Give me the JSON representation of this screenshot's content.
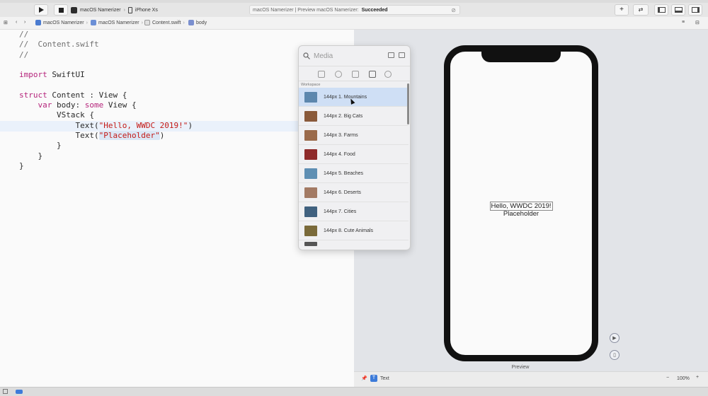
{
  "toolbar": {
    "scheme_app": "macOS Namerizer",
    "scheme_device": "iPhone Xs",
    "status_prefix": "macOS Namerizer | Preview macOS Namerizer:",
    "status_result": "Succeeded"
  },
  "jumpbar": {
    "crumbs": [
      "macOS Namerizer",
      "macOS Namerizer",
      "Content.swift",
      "body"
    ]
  },
  "editor": {
    "lines": [
      "//",
      "//  Content.swift",
      "//",
      "",
      "import SwiftUI",
      "",
      "struct Content : View {",
      "    var body: some View {",
      "        VStack {",
      "            Text(\"Hello, WWDC 2019!\")",
      "            Text(\"Placeholder\")",
      "        }",
      "    }",
      "}"
    ]
  },
  "library": {
    "search_placeholder": "Media",
    "section": "Workspace",
    "items": [
      {
        "label": "144px 1. Mountains",
        "thumb": "#5d87ad"
      },
      {
        "label": "144px 2. Big Cats",
        "thumb": "#8a5a3a"
      },
      {
        "label": "144px 3. Farms",
        "thumb": "#9a6a4a"
      },
      {
        "label": "144px 4. Food",
        "thumb": "#8e2a2a"
      },
      {
        "label": "144px 5. Beaches",
        "thumb": "#5f8fb3"
      },
      {
        "label": "144px 6. Deserts",
        "thumb": "#a37a64"
      },
      {
        "label": "144px 7. Cities",
        "thumb": "#40617f"
      },
      {
        "label": "144px 8. Cute Animals",
        "thumb": "#7a6a3a"
      }
    ]
  },
  "preview": {
    "line1": "Hello, WWDC 2019!",
    "line2": "Placeholder",
    "label": "Preview"
  },
  "canvas_bottom": {
    "selection": "Text",
    "zoom": "100%"
  }
}
